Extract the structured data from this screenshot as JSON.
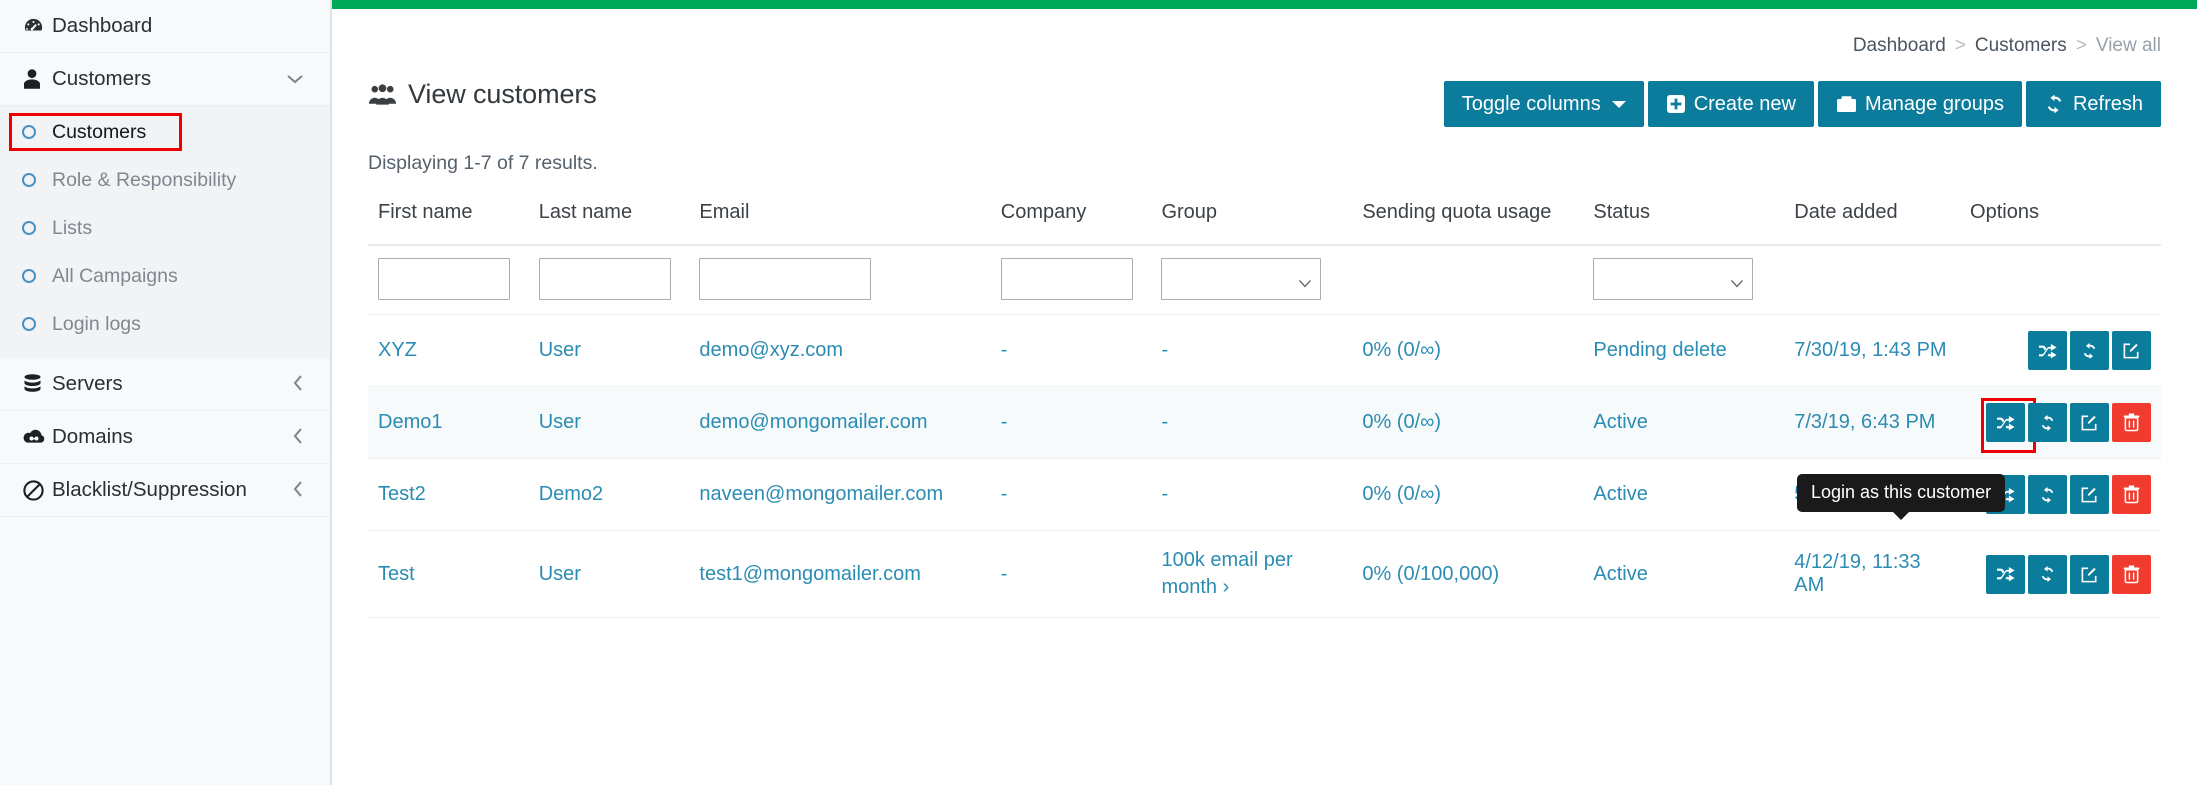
{
  "theme": {
    "accent_teal": "#0b7c9b",
    "accent_green": "#00a859",
    "danger_red": "#f03b2e",
    "link_blue": "#2b8cb3",
    "highlight_red": "#ee0000"
  },
  "sidebar": {
    "items": [
      {
        "label": "Dashboard",
        "icon": "dashboard-icon",
        "caret": ""
      },
      {
        "label": "Customers",
        "icon": "user-icon",
        "caret": "⌄"
      },
      {
        "label": "Servers",
        "icon": "database-icon",
        "caret": "‹"
      },
      {
        "label": "Domains",
        "icon": "cloud-icon",
        "caret": "‹"
      },
      {
        "label": "Blacklist/Suppression",
        "icon": "ban-icon",
        "caret": "‹"
      }
    ],
    "submenu": [
      {
        "label": "Customers",
        "active": true
      },
      {
        "label": "Role & Responsibility",
        "active": false
      },
      {
        "label": "Lists",
        "active": false
      },
      {
        "label": "All Campaigns",
        "active": false
      },
      {
        "label": "Login logs",
        "active": false
      }
    ]
  },
  "breadcrumb": {
    "dashboard": "Dashboard",
    "customers": "Customers",
    "current": "View all",
    "separator": ">"
  },
  "page": {
    "title": "View customers",
    "title_icon": "group-users-icon",
    "results_text": "Displaying 1-7 of 7 results."
  },
  "toolbar": {
    "toggle_columns": "Toggle columns",
    "create_new": "Create new",
    "manage_groups": "Manage groups",
    "refresh": "Refresh"
  },
  "table": {
    "headers": [
      "First name",
      "Last name",
      "Email",
      "Company",
      "Group",
      "Sending quota usage",
      "Status",
      "Date added",
      "Options"
    ],
    "filters": {
      "first_name": "",
      "last_name": "",
      "email": "",
      "company": "",
      "group": "",
      "status": ""
    },
    "rows": [
      {
        "first_name": "XYZ",
        "last_name": "User",
        "email": "demo@xyz.com",
        "company": "-",
        "group": "-",
        "group_is_link": false,
        "quota": "0% (0/∞)",
        "status": "Pending delete",
        "date_added": "7/30/19, 1:43 PM",
        "actions": [
          "login-as-icon",
          "sync-icon",
          "edit-icon"
        ]
      },
      {
        "first_name": "Demo1",
        "last_name": "User",
        "email": "demo@mongomailer.com",
        "company": "-",
        "group": "-",
        "group_is_link": false,
        "quota": "0% (0/∞)",
        "status": "Active",
        "date_added": "7/3/19, 6:43 PM",
        "actions": [
          "login-as-icon",
          "sync-icon",
          "edit-icon",
          "delete-icon"
        ],
        "highlight_action": 0
      },
      {
        "first_name": "Test2",
        "last_name": "Demo2",
        "email": "naveen@mongomailer.com",
        "company": "-",
        "group": "-",
        "group_is_link": false,
        "quota": "0% (0/∞)",
        "status": "Active",
        "date_added": "5/13/19, 5:04 PM",
        "actions": [
          "login-as-icon",
          "sync-icon",
          "edit-icon",
          "delete-icon"
        ]
      },
      {
        "first_name": "Test",
        "last_name": "User",
        "email": "test1@mongomailer.com",
        "company": "-",
        "group": "100k email per month ›",
        "group_is_link": true,
        "quota": "0% (0/100,000)",
        "status": "Active",
        "date_added": "4/12/19, 11:33 AM",
        "actions": [
          "login-as-icon",
          "sync-icon",
          "edit-icon",
          "delete-icon"
        ]
      }
    ]
  },
  "tooltip": {
    "text": "Login as this customer"
  }
}
